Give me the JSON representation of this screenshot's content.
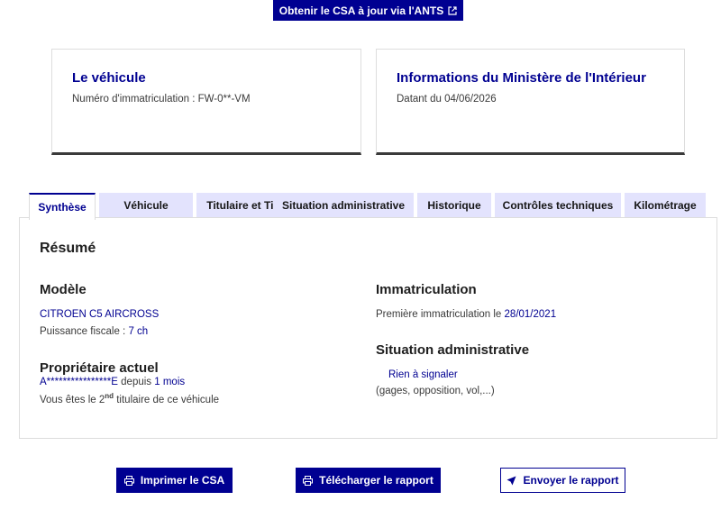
{
  "top_button": {
    "label": "Obtenir le CSA à jour via l'ANTS",
    "icon": "external-link-icon"
  },
  "vehicle_card": {
    "title": "Le véhicule",
    "plate_label": "Numéro d'immatriculation : FW-0**-VM"
  },
  "ministry_card": {
    "title": "Informations du Ministère de l'Intérieur",
    "date_label": "Datant du 04/06/2026"
  },
  "tabs": [
    {
      "label": "Synthèse",
      "active": true
    },
    {
      "label": "Véhicule",
      "active": false
    },
    {
      "label": "Titulaire et Titre",
      "active": false
    },
    {
      "label": "Situation administrative",
      "active": false
    },
    {
      "label": "Historique",
      "active": false
    },
    {
      "label": "Contrôles techniques",
      "active": false
    },
    {
      "label": "Kilométrage",
      "active": false
    }
  ],
  "summary": {
    "title": "Résumé",
    "model": {
      "title": "Modèle",
      "name": "CITROEN C5 AIRCROSS",
      "fiscal_power_label": "Puissance fiscale :",
      "fiscal_power_value": "7 ch"
    },
    "owner": {
      "title": "Propriétaire actuel",
      "name": "A****************E",
      "since_label": "depuis",
      "since_value": "1 mois",
      "rank_prefix": "Vous êtes le 2",
      "rank_sup": "nd",
      "rank_suffix": "titulaire de ce véhicule"
    },
    "registration": {
      "title": "Immatriculation",
      "first_label": "Première immatriculation le",
      "first_date": "28/01/2021"
    },
    "admin": {
      "title": "Situation administrative",
      "status": "Rien à signaler",
      "detail": "(gages, opposition, vol,...)"
    }
  },
  "actions": {
    "print": {
      "label": "Imprimer le CSA",
      "icon": "printer-icon"
    },
    "download": {
      "label": "Télécharger le rapport",
      "icon": "printer-icon"
    },
    "send": {
      "label": "Envoyer le rapport",
      "icon": "send-icon"
    }
  },
  "colors": {
    "primary": "#000091",
    "tab_bg": "#e3e3fd",
    "border": "#dddddd"
  }
}
